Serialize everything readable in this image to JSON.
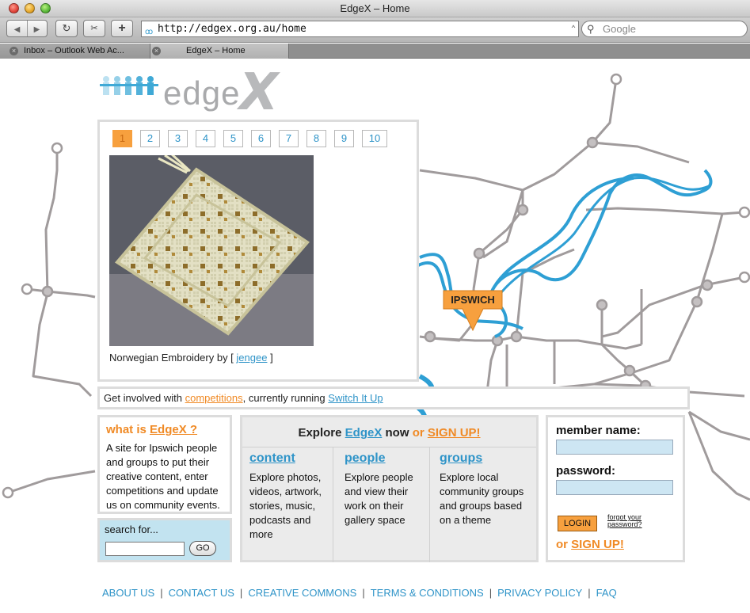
{
  "browser": {
    "window_title": "EdgeX – Home",
    "url": "http://edgex.org.au/home",
    "search_placeholder": "Google",
    "tabs": [
      {
        "label": "Inbox – Outlook Web Ac..."
      },
      {
        "label": "EdgeX – Home"
      }
    ]
  },
  "logo": {
    "text": "edge",
    "x": "X"
  },
  "map": {
    "label": "IPSWICH"
  },
  "gallery": {
    "pages": [
      "1",
      "2",
      "3",
      "4",
      "5",
      "6",
      "7",
      "8",
      "9",
      "10"
    ],
    "active_page": "1",
    "caption_prefix": "Norwegian Embroidery by [",
    "caption_author": "jengee",
    "caption_suffix": "]"
  },
  "involved": {
    "prefix": "Get involved with",
    "competitions": "competitions",
    "middle": ", currently running",
    "running": "Switch It Up"
  },
  "whatis": {
    "title_prefix": "what is",
    "title_link": "EdgeX ?",
    "body": "A site for Ipswich people and groups to put their creative content, enter competitions and update us on community events."
  },
  "search": {
    "label": "search for...",
    "go": "GO"
  },
  "explore": {
    "hdr_prefix": "Explore",
    "hdr_brand": "EdgeX",
    "hdr_now": "now",
    "hdr_or": "or",
    "hdr_signup": "SIGN UP!",
    "columns": [
      {
        "title": "content",
        "body": "Explore photos, videos, artwork, stories, music, podcasts and more"
      },
      {
        "title": "people",
        "body": "Explore people and view their work on their gallery space"
      },
      {
        "title": "groups",
        "body": "Explore local community groups and groups based on a theme"
      }
    ]
  },
  "login": {
    "member_label": "member name:",
    "password_label": "password:",
    "login_button": "LOGIN",
    "forgot": "forgot your password?",
    "or": "or",
    "signup": "SIGN UP!"
  },
  "footer": {
    "links": [
      "ABOUT US",
      "CONTACT US",
      "CREATIVE COMMONS",
      "TERMS & CONDITIONS",
      "PRIVACY POLICY",
      "FAQ"
    ],
    "separator": "|"
  },
  "colors": {
    "accent_orange": "#f08a25",
    "link_blue": "#2f94c8",
    "river": "#2e9fd4",
    "rail": "#a09b9c"
  }
}
